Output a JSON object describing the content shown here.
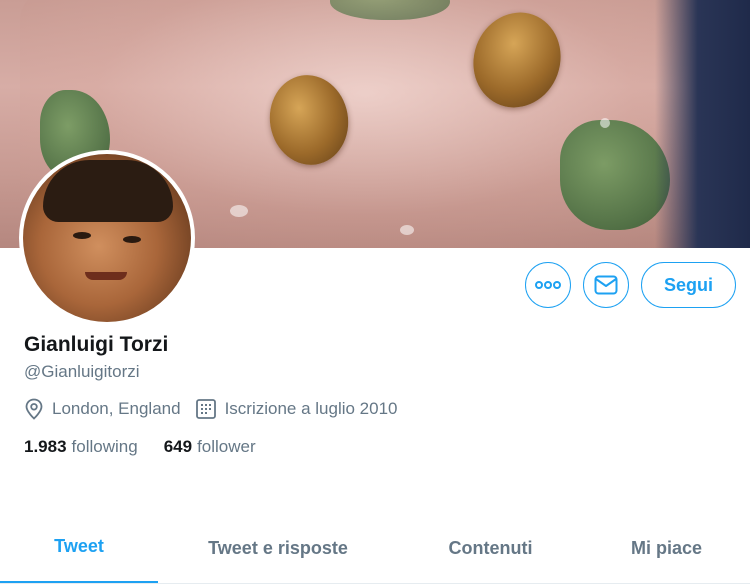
{
  "profile": {
    "name": "Gianluigi Torzi",
    "handle": "@Gianluigitorzi",
    "location": "London, England",
    "joined": "Iscrizione a luglio 2010"
  },
  "stats": {
    "following_count": "1.983",
    "following_label": "following",
    "followers_count": "649",
    "followers_label": "follower"
  },
  "actions": {
    "more_icon": "more-dots-icon",
    "message_icon": "envelope-icon",
    "follow_label": "Segui"
  },
  "tabs": [
    {
      "label": "Tweet",
      "active": true
    },
    {
      "label": "Tweet e risposte",
      "active": false
    },
    {
      "label": "Contenuti",
      "active": false
    },
    {
      "label": "Mi piace",
      "active": false
    }
  ],
  "colors": {
    "accent": "#1da1f2",
    "text_primary": "#14171a",
    "text_secondary": "#657786"
  }
}
